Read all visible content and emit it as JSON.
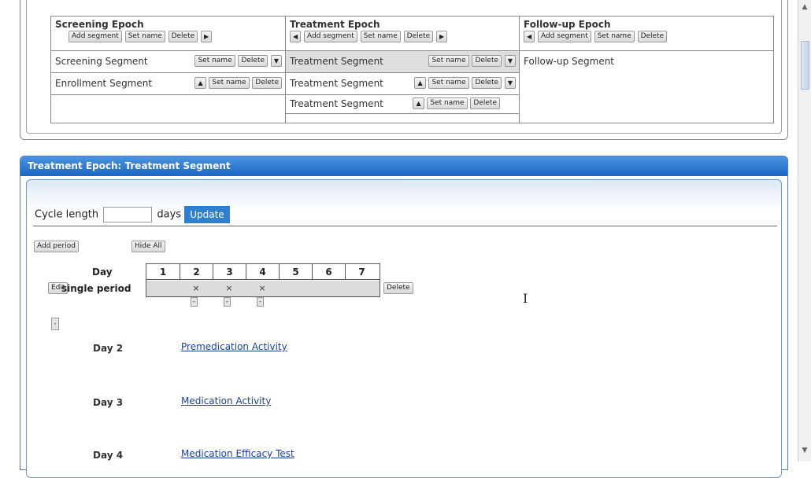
{
  "epochs": [
    {
      "title": "Screening Epoch",
      "buttons": [
        "Add segment",
        "Set name",
        "Delete",
        "▶"
      ],
      "segments": [
        {
          "name": "Screening Segment",
          "buttons": [
            "Set name",
            "Delete",
            "▼"
          ]
        },
        {
          "name": "Enrollment Segment",
          "buttons": [
            "▲",
            "Set name",
            "Delete"
          ]
        }
      ]
    },
    {
      "title": "Treatment Epoch",
      "buttons": [
        "◀",
        "Add segment",
        "Set name",
        "Delete",
        "▶"
      ],
      "segments": [
        {
          "name": "Treatment Segment",
          "buttons": [
            "Set name",
            "Delete",
            "▼"
          ]
        },
        {
          "name": "Treatment Segment",
          "buttons": [
            "▲",
            "Set name",
            "Delete",
            "▼"
          ]
        },
        {
          "name": "Treatment Segment",
          "buttons": [
            "▲",
            "Set name",
            "Delete"
          ]
        }
      ]
    },
    {
      "title": "Follow-up Epoch",
      "buttons": [
        "◀",
        "Add segment",
        "Set name",
        "Delete"
      ],
      "segments": [
        {
          "name": "Follow-up Segment",
          "buttons": []
        }
      ]
    }
  ],
  "segment_panel": {
    "title": "Treatment Epoch: Treatment Segment",
    "cycle_label": "Cycle length",
    "cycle_value": "",
    "days_label": "days",
    "update_label": "Update",
    "add_period_label": "Add period",
    "hide_all_label": "Hide All",
    "day_label": "Day",
    "edit_label": "Edit",
    "period_name": "single period",
    "days": [
      "1",
      "2",
      "3",
      "4",
      "5",
      "6",
      "7"
    ],
    "marks": [
      "",
      "×",
      "×",
      "×",
      "",
      "",
      ""
    ],
    "minus_label": "-",
    "delete_label": "Delete",
    "collapse_label": "-"
  },
  "activities": [
    {
      "day": "Day 2",
      "activity": "Premedication Activity"
    },
    {
      "day": "Day 3",
      "activity": "Medication Activity"
    },
    {
      "day": "Day 4",
      "activity": "Medication Efficacy Test"
    }
  ],
  "cursor_glyph": "I",
  "scrollbar": {
    "up_glyph": "▲",
    "down_glyph": "▼"
  }
}
